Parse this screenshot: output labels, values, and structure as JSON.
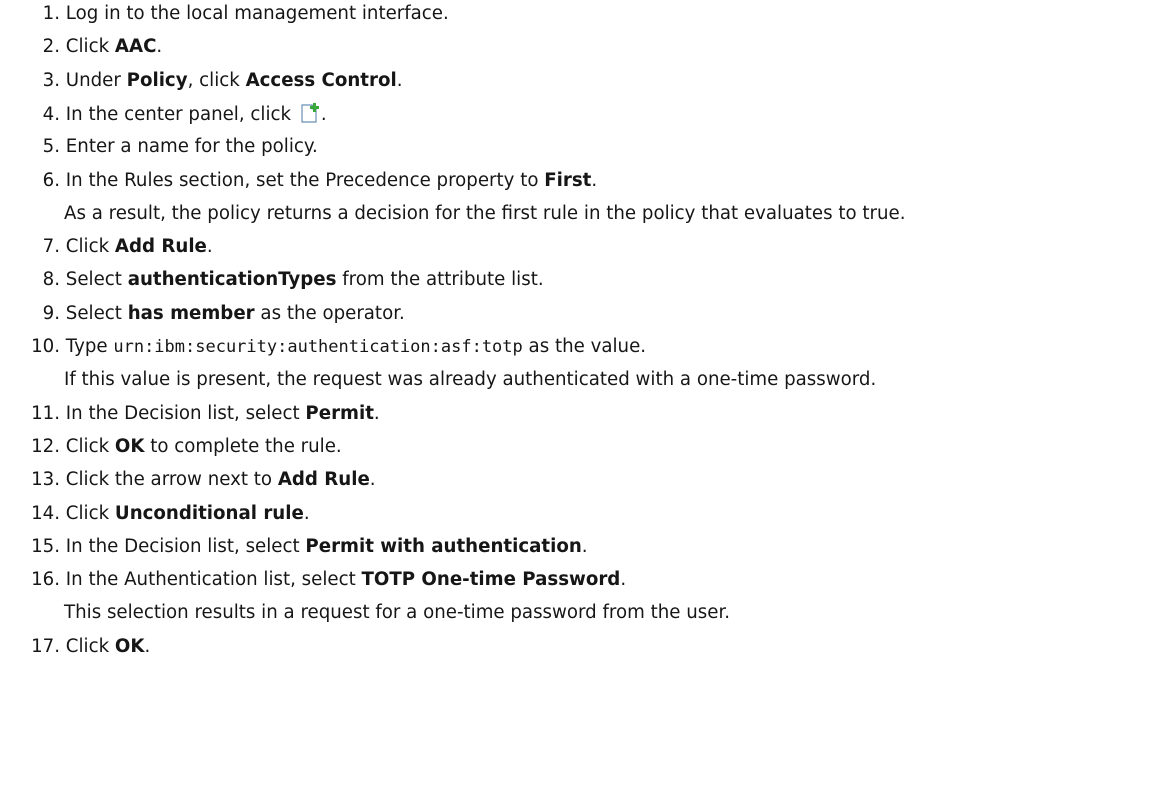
{
  "steps": [
    {
      "num": "1.",
      "parts": [
        {
          "t": "Log in to the local management interface."
        }
      ]
    },
    {
      "num": "2.",
      "parts": [
        {
          "t": "Click "
        },
        {
          "b": "AAC"
        },
        {
          "t": "."
        }
      ]
    },
    {
      "num": "3.",
      "parts": [
        {
          "t": "Under "
        },
        {
          "b": "Policy"
        },
        {
          "t": ", click "
        },
        {
          "b": "Access Control"
        },
        {
          "t": "."
        }
      ]
    },
    {
      "num": "4.",
      "parts": [
        {
          "t": "In the center panel, click "
        },
        {
          "icon": "add-policy-icon"
        },
        {
          "t": "."
        }
      ]
    },
    {
      "num": "5.",
      "parts": [
        {
          "t": "Enter a name for the policy."
        }
      ]
    },
    {
      "num": "6.",
      "parts": [
        {
          "t": "In the Rules section, set the Precedence property to "
        },
        {
          "b": "First"
        },
        {
          "t": "."
        }
      ],
      "note": "As a result, the policy returns a decision for the first rule in the policy that evaluates to true."
    },
    {
      "num": "7.",
      "parts": [
        {
          "t": "Click "
        },
        {
          "b": "Add Rule"
        },
        {
          "t": "."
        }
      ]
    },
    {
      "num": "8.",
      "parts": [
        {
          "t": "Select "
        },
        {
          "b": "authenticationTypes"
        },
        {
          "t": " from the attribute list."
        }
      ]
    },
    {
      "num": "9.",
      "parts": [
        {
          "t": "Select "
        },
        {
          "b": "has member"
        },
        {
          "t": " as the operator."
        }
      ]
    },
    {
      "num": "10.",
      "parts": [
        {
          "t": "Type "
        },
        {
          "code": "urn:ibm:security:authentication:asf:totp"
        },
        {
          "t": " as the value."
        }
      ],
      "note": "If this value is present, the request was already authenticated with a one-time password."
    },
    {
      "num": "11.",
      "parts": [
        {
          "t": "In the Decision list, select "
        },
        {
          "b": "Permit"
        },
        {
          "t": "."
        }
      ]
    },
    {
      "num": "12.",
      "parts": [
        {
          "t": "Click "
        },
        {
          "b": "OK"
        },
        {
          "t": " to complete the rule."
        }
      ]
    },
    {
      "num": "13.",
      "parts": [
        {
          "t": "Click the arrow next to "
        },
        {
          "b": "Add Rule"
        },
        {
          "t": "."
        }
      ]
    },
    {
      "num": "14.",
      "parts": [
        {
          "t": "Click "
        },
        {
          "b": "Unconditional rule"
        },
        {
          "t": "."
        }
      ]
    },
    {
      "num": "15.",
      "parts": [
        {
          "t": "In the Decision list, select "
        },
        {
          "b": "Permit with authentication"
        },
        {
          "t": "."
        }
      ]
    },
    {
      "num": "16.",
      "parts": [
        {
          "t": "In the Authentication list, select "
        },
        {
          "b": "TOTP One-time Password"
        },
        {
          "t": "."
        }
      ],
      "note": "This selection results in a request for a one-time password from the user."
    },
    {
      "num": "17.",
      "parts": [
        {
          "t": "Click "
        },
        {
          "b": "OK"
        },
        {
          "t": "."
        }
      ]
    }
  ],
  "colors": {
    "text": "#161616",
    "icon_page": "#ffffff",
    "icon_border": "#6a8fb8",
    "icon_plus": "#3aa83a"
  }
}
